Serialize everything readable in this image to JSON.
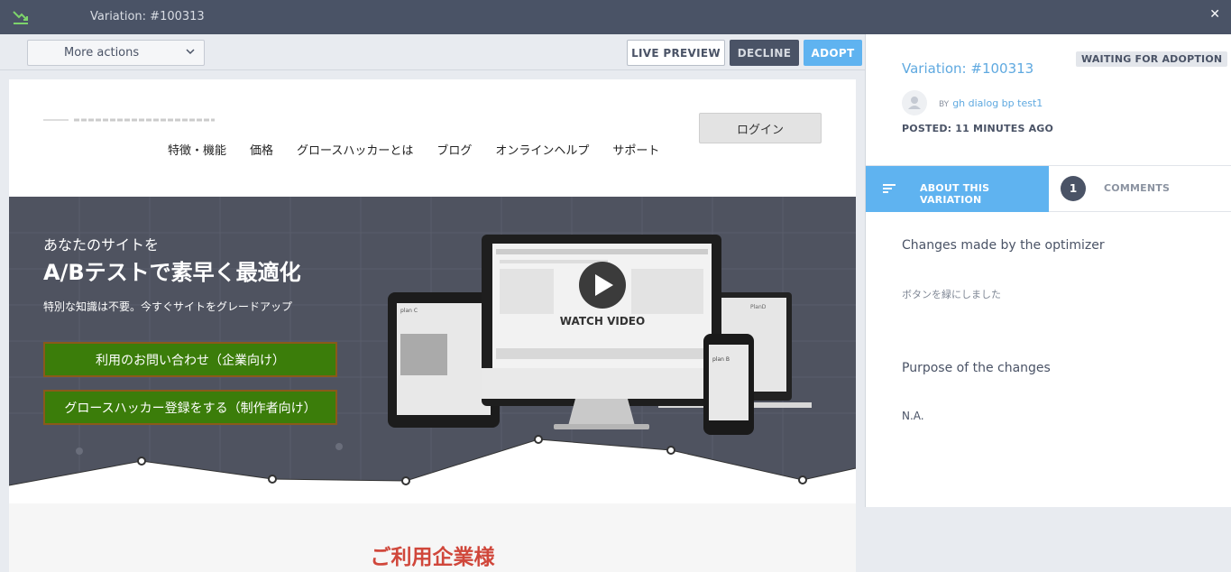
{
  "window": {
    "title": "Variation: #100313",
    "close_label": "✕"
  },
  "toolbar": {
    "more_actions_label": "More actions",
    "live_preview_label": "LIVE PREVIEW",
    "decline_label": "DECLINE",
    "adopt_label": "ADOPT"
  },
  "preview": {
    "login_label": "ログイン",
    "nav": [
      "特徴・機能",
      "価格",
      "グロースハッカーとは",
      "ブログ",
      "オンラインヘルプ",
      "サポート"
    ],
    "hero_sub": "あなたのサイトを",
    "hero_main": "A/Bテストで素早く最適化",
    "hero_desc": "特別な知識は不要。今すぐサイトをグレードアップ",
    "cta_1": "利用のお問い合わせ（企業向け）",
    "cta_2": "グロースハッカー登録をする（制作者向け）",
    "video_label": "WATCH VIDEO",
    "section_heading": "ご利用企業様"
  },
  "panel": {
    "variation_title": "Variation: #100313",
    "status_badge": "WAITING FOR ADOPTION",
    "by_label": "BY",
    "author": "gh dialog bp test1",
    "posted": "POSTED: 11 MINUTES AGO",
    "tab_about": "ABOUT THIS VARIATION",
    "comments_count": "1",
    "tab_comments": "COMMENTS",
    "changes_heading": "Changes made by the optimizer",
    "changes_body": "ボタンを緑にしました",
    "purpose_heading": "Purpose of the changes",
    "purpose_body": "N.A."
  },
  "colors": {
    "topbar": "#4a5366",
    "accent": "#5fb3f0",
    "cta_green": "#3b7d0a",
    "heading_red": "#d0473b"
  }
}
